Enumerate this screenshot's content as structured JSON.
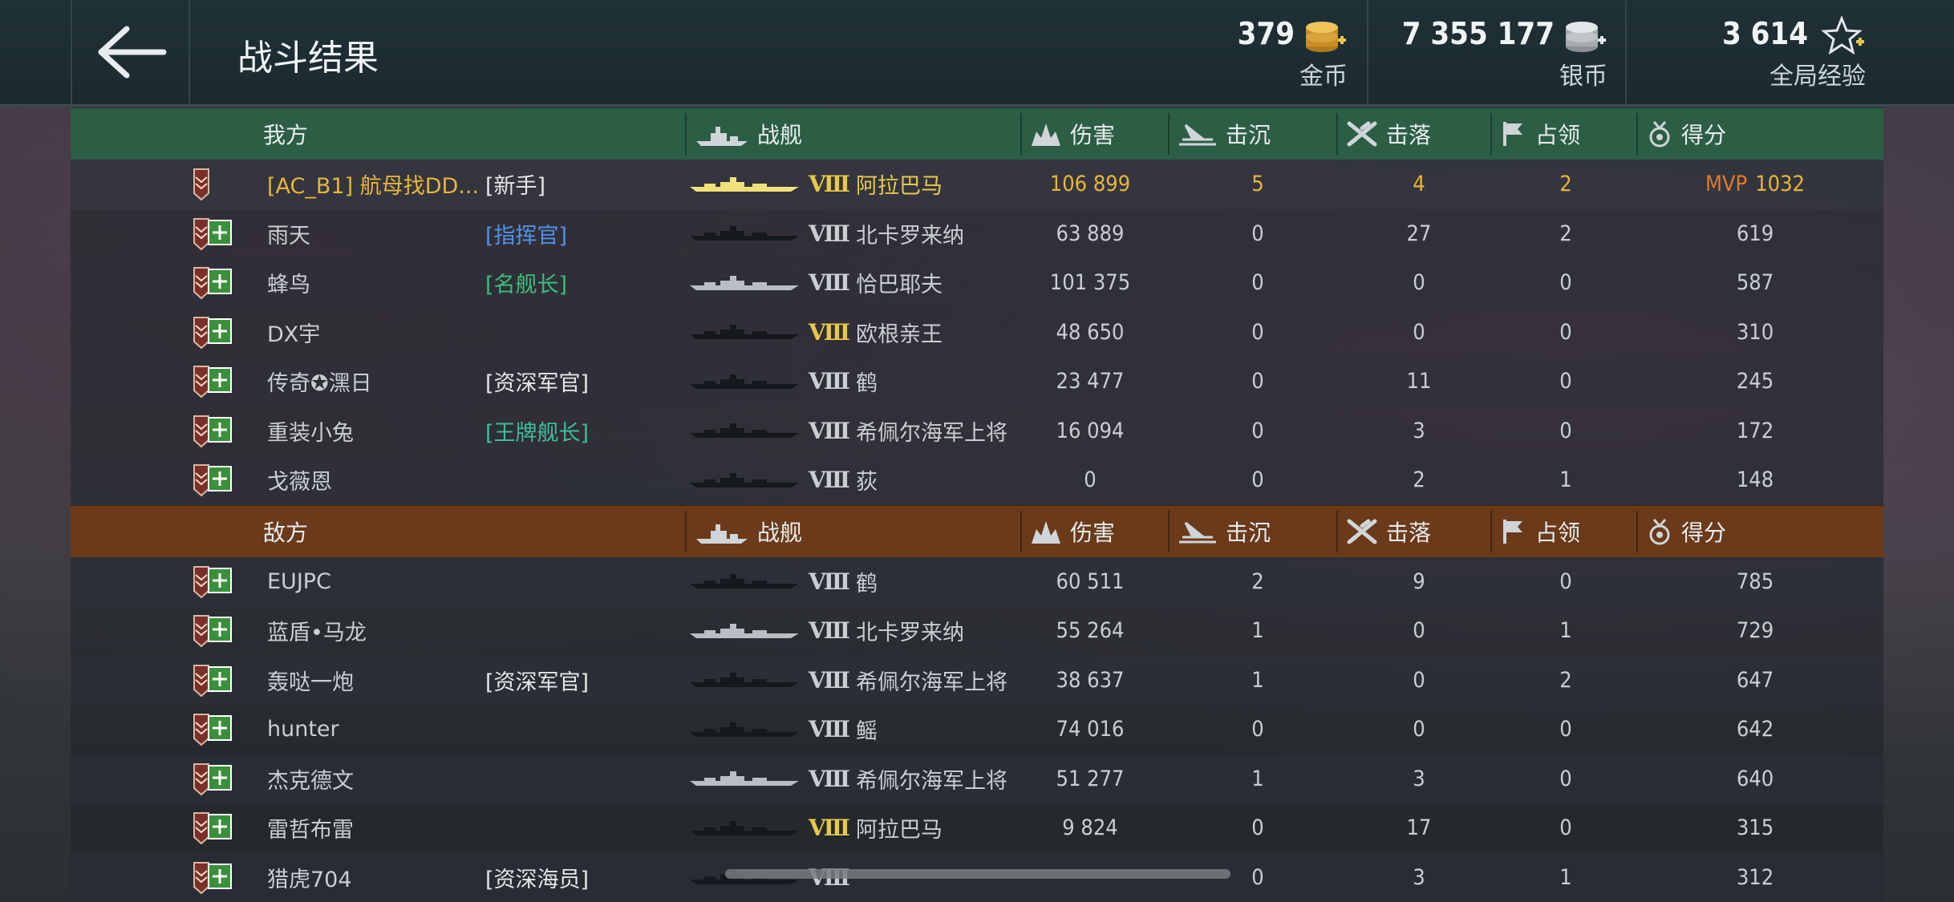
{
  "header": {
    "title": "战斗结果",
    "gold": {
      "value": "379",
      "label": "金币"
    },
    "silver": {
      "value": "7 355 177",
      "label": "银币"
    },
    "xp": {
      "value": "3 614",
      "label": "全局经验"
    }
  },
  "columns": {
    "ship": "战舰",
    "damage": "伤害",
    "kills": "击沉",
    "planes": "击落",
    "capture": "占领",
    "score": "得分"
  },
  "ally": {
    "label": "我方",
    "rows": [
      {
        "name": "[AC_B1] 航母找DD...",
        "title": "[新手]",
        "title_color": "#e6e6e6",
        "tier": "VIII",
        "ship": "阿拉巴马",
        "damage": "106 899",
        "kills": "5",
        "planes": "4",
        "capture": "2",
        "mvp": "MVP",
        "score": "1032",
        "highlight": true,
        "premium": true
      },
      {
        "name": "雨天",
        "title": "[指挥官]",
        "title_color": "#4e93e8",
        "tier": "VIII",
        "ship": "北卡罗来纳",
        "damage": "63 889",
        "kills": "0",
        "planes": "27",
        "capture": "2",
        "score": "619"
      },
      {
        "name": "蜂鸟",
        "title": "[名舰长]",
        "title_color": "#3dbd7a",
        "tier": "VIII",
        "ship": "恰巴耶夫",
        "damage": "101 375",
        "kills": "0",
        "planes": "0",
        "capture": "0",
        "score": "587"
      },
      {
        "name": "DX宇",
        "title": "",
        "title_color": "#e6e6e6",
        "tier": "VIII",
        "ship": "欧根亲王",
        "damage": "48 650",
        "kills": "0",
        "planes": "0",
        "capture": "0",
        "score": "310",
        "premium": true
      },
      {
        "name": "传奇✪潶日",
        "title": "[资深军官]",
        "title_color": "#e6e6e6",
        "tier": "VIII",
        "ship": "鹤",
        "damage": "23 477",
        "kills": "0",
        "planes": "11",
        "capture": "0",
        "score": "245"
      },
      {
        "name": "重装小兔",
        "title": "[王牌舰长]",
        "title_color": "#3dbd9a",
        "tier": "VIII",
        "ship": "希佩尔海军上将",
        "damage": "16 094",
        "kills": "0",
        "planes": "3",
        "capture": "0",
        "score": "172"
      },
      {
        "name": "戈薇恩",
        "title": "",
        "title_color": "#e6e6e6",
        "tier": "VIII",
        "ship": "荻",
        "damage": "0",
        "kills": "0",
        "planes": "2",
        "capture": "1",
        "score": "148"
      }
    ]
  },
  "enemy": {
    "label": "敌方",
    "rows": [
      {
        "name": "EUJPC",
        "title": "",
        "title_color": "#e6e6e6",
        "tier": "VIII",
        "ship": "鹤",
        "damage": "60 511",
        "kills": "2",
        "planes": "9",
        "capture": "0",
        "score": "785"
      },
      {
        "name": "蓝盾•马龙",
        "title": "",
        "title_color": "#e6e6e6",
        "tier": "VIII",
        "ship": "北卡罗来纳",
        "damage": "55 264",
        "kills": "1",
        "planes": "0",
        "capture": "1",
        "score": "729"
      },
      {
        "name": "轰哒一炮",
        "title": "[资深军官]",
        "title_color": "#e6e6e6",
        "tier": "VIII",
        "ship": "希佩尔海军上将",
        "damage": "38 637",
        "kills": "1",
        "planes": "0",
        "capture": "2",
        "score": "647"
      },
      {
        "name": "hunter",
        "title": "",
        "title_color": "#e6e6e6",
        "tier": "VIII",
        "ship": "鳐",
        "damage": "74 016",
        "kills": "0",
        "planes": "0",
        "capture": "0",
        "score": "642"
      },
      {
        "name": "杰克德文",
        "title": "",
        "title_color": "#e6e6e6",
        "tier": "VIII",
        "ship": "希佩尔海军上将",
        "damage": "51 277",
        "kills": "1",
        "planes": "3",
        "capture": "0",
        "score": "640"
      },
      {
        "name": "雷哲布雷",
        "title": "",
        "title_color": "#e6e6e6",
        "tier": "VIII",
        "ship": "阿拉巴马",
        "damage": "9 824",
        "kills": "0",
        "planes": "17",
        "capture": "0",
        "score": "315",
        "premium": true
      },
      {
        "name": "猎虎704",
        "title": "[资深海员]",
        "title_color": "#e6e6e6",
        "tier": "VIII",
        "ship": "",
        "damage": "",
        "kills": "0",
        "planes": "3",
        "capture": "1",
        "score": "312"
      }
    ]
  },
  "colors": {
    "ally_header": "#2c5e45",
    "enemy_header": "#6a3a1a",
    "highlight_text": "#e8b53a",
    "mvp": "#e07a2a",
    "premium_tier": "#e8c84a",
    "normal_tier": "#c9ced3"
  },
  "icons": [
    "back-arrow-icon",
    "gold-coins-icon",
    "silver-coins-icon",
    "xp-star-icon",
    "ship-icon",
    "damage-icon",
    "kills-icon",
    "planes-icon",
    "capture-flag-icon",
    "score-medal-icon",
    "rank-insignia-icon"
  ]
}
